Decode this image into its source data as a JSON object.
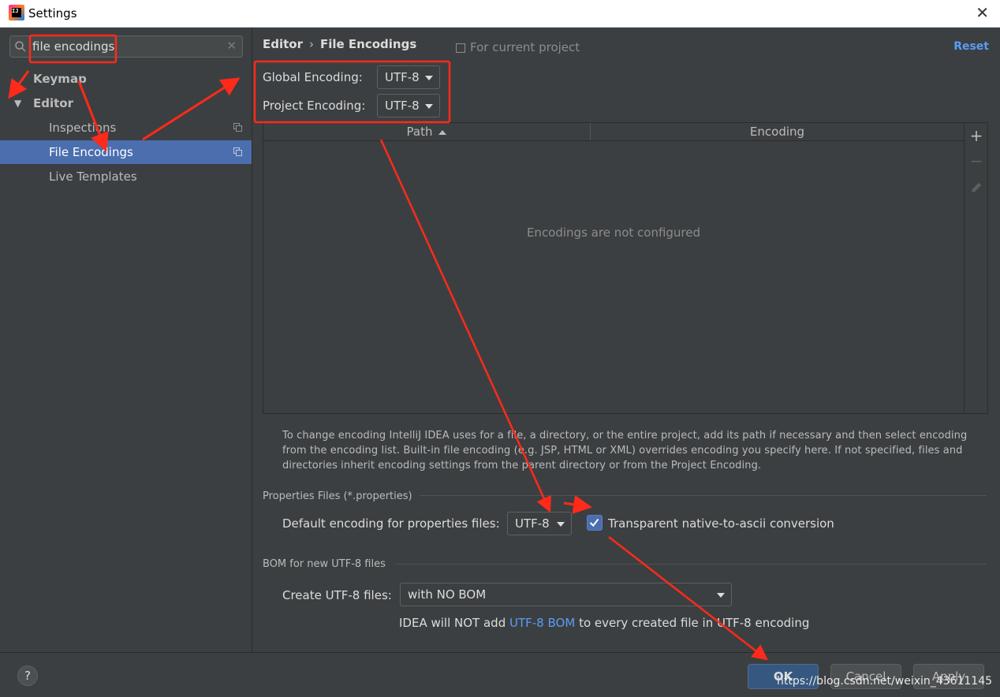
{
  "window": {
    "title": "Settings"
  },
  "sidebar": {
    "search_value": "file encodings",
    "items": [
      {
        "label": "Keymap"
      },
      {
        "label": "Editor"
      },
      {
        "label": "Inspections"
      },
      {
        "label": "File Encodings"
      },
      {
        "label": "Live Templates"
      }
    ]
  },
  "main": {
    "breadcrumb": {
      "parent": "Editor",
      "current": "File Encodings"
    },
    "scope_label": "For current project",
    "reset_label": "Reset",
    "global_encoding": {
      "label": "Global Encoding:",
      "value": "UTF-8"
    },
    "project_encoding": {
      "label": "Project Encoding:",
      "value": "UTF-8"
    },
    "table": {
      "columns": [
        "Path",
        "Encoding"
      ],
      "empty_text": "Encodings are not configured"
    },
    "help_text": "To change encoding IntelliJ IDEA uses for a file, a directory, or the entire project, add its path if necessary and then select encoding from the encoding list. Built-in file encoding (e.g. JSP, HTML or XML) overrides encoding you specify here. If not specified, files and directories inherit encoding settings from the parent directory or from the Project Encoding.",
    "properties": {
      "section_title": "Properties Files (*.properties)",
      "default_label": "Default encoding for properties files:",
      "default_value": "UTF-8",
      "transparent_label": "Transparent native-to-ascii conversion",
      "transparent_checked": true
    },
    "bom": {
      "section_title": "BOM for new UTF-8 files",
      "create_label": "Create UTF-8 files:",
      "create_value": "with NO BOM",
      "note_prefix": "IDEA will NOT add",
      "note_link": "UTF-8 BOM",
      "note_suffix": "to every created file in UTF-8 encoding"
    }
  },
  "buttons": {
    "help": "?",
    "ok": "OK",
    "cancel": "Cancel",
    "apply": "Apply"
  },
  "watermark": "https://blog.csdn.net/weixin_43611145",
  "icons": {
    "app": "intellij-idea-icon",
    "search": "search-icon",
    "clear": "clear-icon",
    "add": "add-icon",
    "remove": "remove-icon",
    "edit": "edit-icon"
  },
  "colors": {
    "annotation": "#ff2a1a",
    "selection": "#4b6eaf",
    "link": "#589df6",
    "background": "#3c3f41"
  }
}
